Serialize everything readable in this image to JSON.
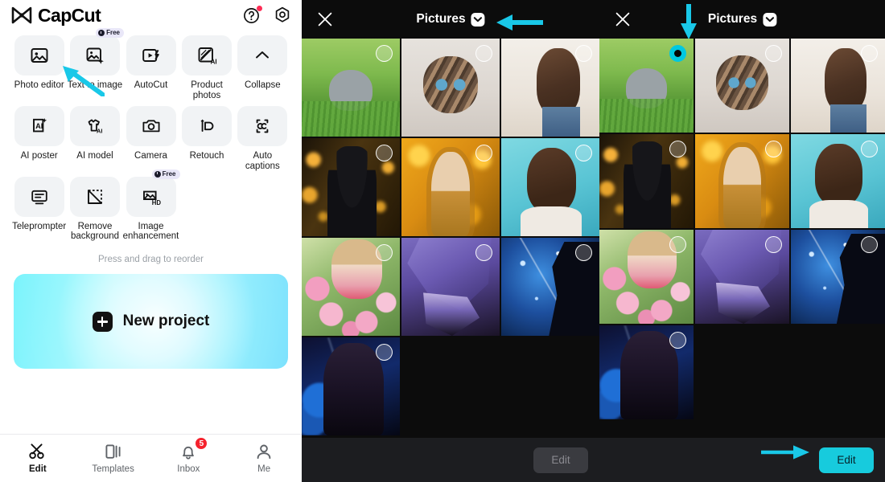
{
  "app": {
    "brand": "CapCut",
    "header_icons": [
      {
        "name": "help-icon",
        "glyph": "?",
        "has_dot": true
      },
      {
        "name": "settings-icon",
        "glyph": "gear"
      }
    ]
  },
  "tools": {
    "reorder_hint": "Press and drag to reorder",
    "items": [
      {
        "label": "Photo editor",
        "icon": "photo-editor-icon",
        "badge": null
      },
      {
        "label": "Text to image",
        "icon": "text-to-image-icon",
        "badge": "Free"
      },
      {
        "label": "AutoCut",
        "icon": "autocut-icon",
        "badge": null
      },
      {
        "label": "Product photos",
        "icon": "product-photos-icon",
        "badge": null
      },
      {
        "label": "Collapse",
        "icon": "chevron-up-icon",
        "badge": null
      },
      {
        "label": "AI poster",
        "icon": "ai-poster-icon",
        "badge": null
      },
      {
        "label": "AI model",
        "icon": "ai-model-icon",
        "badge": null
      },
      {
        "label": "Camera",
        "icon": "camera-icon",
        "badge": null
      },
      {
        "label": "Retouch",
        "icon": "retouch-icon",
        "badge": null
      },
      {
        "label": "Auto captions",
        "icon": "auto-captions-icon",
        "badge": null
      },
      {
        "label": "Teleprompter",
        "icon": "teleprompter-icon",
        "badge": null
      },
      {
        "label": "Remove background",
        "icon": "remove-background-icon",
        "badge": null
      },
      {
        "label": "Image enhancement",
        "icon": "image-enhancement-icon",
        "badge": "Free"
      }
    ]
  },
  "new_project": {
    "label": "New project",
    "icon": "plus-icon"
  },
  "bottom_nav": {
    "items": [
      {
        "label": "Edit",
        "icon": "scissors-icon",
        "active": true,
        "badge": null
      },
      {
        "label": "Templates",
        "icon": "templates-icon",
        "active": false,
        "badge": null
      },
      {
        "label": "Inbox",
        "icon": "bell-icon",
        "active": false,
        "badge": "5"
      },
      {
        "label": "Me",
        "icon": "person-icon",
        "active": false,
        "badge": null
      }
    ]
  },
  "picker_left": {
    "close_icon": "close-icon",
    "title": "Pictures",
    "chevron_icon": "chevron-down-icon",
    "edit_label": "Edit",
    "edit_enabled": false,
    "selected_count": 0,
    "items": [
      {
        "name": "gray-kitten-on-grass",
        "art": "art-kitten1",
        "selected": false
      },
      {
        "name": "tabby-kitten-indoors",
        "art": "art-kitten2",
        "selected": false
      },
      {
        "name": "girl-with-flower-crown",
        "art": "art-girl-flower",
        "selected": false
      },
      {
        "name": "girl-in-black-beanie",
        "art": "art-beanie",
        "selected": false
      },
      {
        "name": "girl-with-autumn-leaves",
        "art": "art-autumn",
        "selected": false
      },
      {
        "name": "smiling-girl-teal-background",
        "art": "art-teal",
        "selected": false
      },
      {
        "name": "child-with-pink-roses",
        "art": "art-roses",
        "selected": false
      },
      {
        "name": "anime-purple-cloak",
        "art": "art-purple",
        "selected": false
      },
      {
        "name": "anime-blue-starry-silhouette",
        "art": "art-blue",
        "selected": false
      },
      {
        "name": "anime-girl-blue-night",
        "art": "art-night",
        "selected": false
      }
    ]
  },
  "picker_right": {
    "close_icon": "close-icon",
    "title": "Pictures",
    "chevron_icon": "chevron-down-icon",
    "edit_label": "Edit",
    "edit_enabled": true,
    "selected_count": 1,
    "items": [
      {
        "name": "gray-kitten-on-grass",
        "art": "art-kitten1",
        "selected": true
      },
      {
        "name": "tabby-kitten-indoors",
        "art": "art-kitten2",
        "selected": false
      },
      {
        "name": "girl-with-flower-crown",
        "art": "art-girl-flower",
        "selected": false
      },
      {
        "name": "girl-in-black-beanie",
        "art": "art-beanie",
        "selected": false
      },
      {
        "name": "girl-with-autumn-leaves",
        "art": "art-autumn",
        "selected": false
      },
      {
        "name": "smiling-girl-teal-background",
        "art": "art-teal",
        "selected": false
      },
      {
        "name": "child-with-pink-roses",
        "art": "art-roses",
        "selected": false
      },
      {
        "name": "anime-purple-cloak",
        "art": "art-purple",
        "selected": false
      },
      {
        "name": "anime-blue-starry-silhouette",
        "art": "art-blue",
        "selected": false
      },
      {
        "name": "anime-girl-blue-night",
        "art": "art-night",
        "selected": false
      }
    ]
  },
  "annotations": {
    "color": "#19c8e8",
    "arrows": [
      {
        "name": "arrow-to-photo-editor",
        "direction": "up-left"
      },
      {
        "name": "arrow-to-pictures-title-left",
        "direction": "left"
      },
      {
        "name": "arrow-to-pictures-title-right",
        "direction": "down"
      },
      {
        "name": "arrow-to-edit-button",
        "direction": "right"
      }
    ]
  },
  "colors": {
    "accent": "#19c8e8",
    "badge_red": "#f5222d",
    "selected_dot": "#00c8e0",
    "tile_bg": "#f1f3f5",
    "picker_bg": "#0c0c0c"
  }
}
